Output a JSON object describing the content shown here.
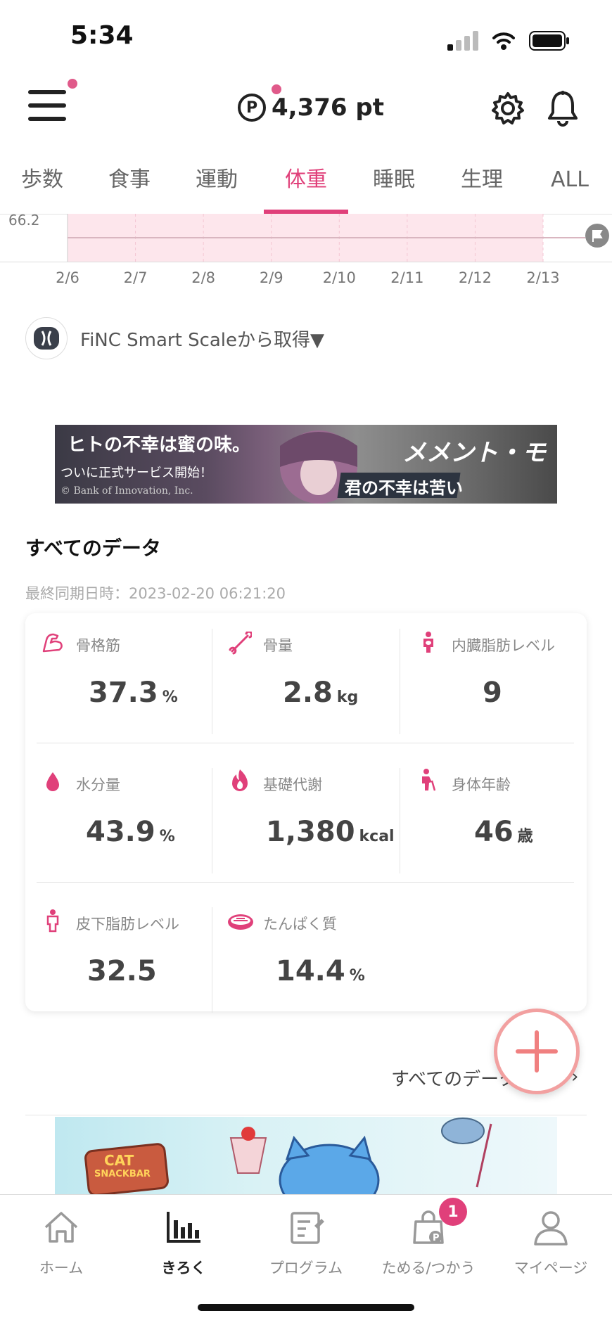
{
  "status_bar": {
    "time": "5:34"
  },
  "header": {
    "points": "4,376 pt",
    "points_symbol": "P"
  },
  "tabs": [
    {
      "label": "歩数"
    },
    {
      "label": "食事"
    },
    {
      "label": "運動"
    },
    {
      "label": "体重"
    },
    {
      "label": "睡眠"
    },
    {
      "label": "生理"
    },
    {
      "label": "ALL"
    }
  ],
  "active_tab": "体重",
  "chart_data": {
    "type": "line",
    "y_label_visible": "66.2",
    "x": [
      "2/6",
      "2/7",
      "2/8",
      "2/9",
      "2/10",
      "2/11",
      "2/12",
      "2/13"
    ],
    "series": [
      {
        "values": [
          66.2,
          66.2,
          66.2,
          66.2,
          66.2,
          66.2,
          66.2,
          66.2
        ]
      }
    ]
  },
  "source": {
    "label": "FiNC Smart Scaleから取得▼"
  },
  "banner_top": {
    "left_title": "ヒトの不幸は蜜の味。",
    "left_sub": "ついに正式サービス開始！",
    "copyright": "© Bank of Innovation, Inc.",
    "right_title": "メメント・モリ",
    "right_sub": "君の不幸は苦い"
  },
  "all_data": {
    "title": "すべてのデータ",
    "sync_label": "最終同期日時：2023-02-20 06:21:20",
    "metrics": [
      {
        "label": "骨格筋",
        "value": "37.3",
        "unit": "%"
      },
      {
        "label": "骨量",
        "value": "2.8",
        "unit": "kg"
      },
      {
        "label": "内臓脂肪レベル",
        "value": "9",
        "unit": ""
      },
      {
        "label": "水分量",
        "value": "43.9",
        "unit": "%"
      },
      {
        "label": "基礎代謝",
        "value": "1,380",
        "unit": "kcal"
      },
      {
        "label": "身体年齢",
        "value": "46",
        "unit": "歳"
      },
      {
        "label": "皮下脂肪レベル",
        "value": "32.5",
        "unit": ""
      },
      {
        "label": "たんぱく質",
        "value": "14.4",
        "unit": "%"
      }
    ],
    "link_label": "すべてのデータ",
    "link_chevron": "›"
  },
  "banner_bottom": {
    "logo_top": "CAT",
    "logo_bottom": "SNACKBAR"
  },
  "bottom_nav": [
    {
      "label": "ホーム",
      "icon": "home-icon"
    },
    {
      "label": "きろく",
      "icon": "bar-chart-icon"
    },
    {
      "label": "プログラム",
      "icon": "notebook-icon"
    },
    {
      "label": "ためる/つかう",
      "icon": "points-bag-icon",
      "badge": "1"
    },
    {
      "label": "マイページ",
      "icon": "person-icon"
    }
  ],
  "colors": {
    "accent": "#e0407a",
    "fab_ring": "#f2a0a0",
    "chart_band": "#fde6ec"
  }
}
